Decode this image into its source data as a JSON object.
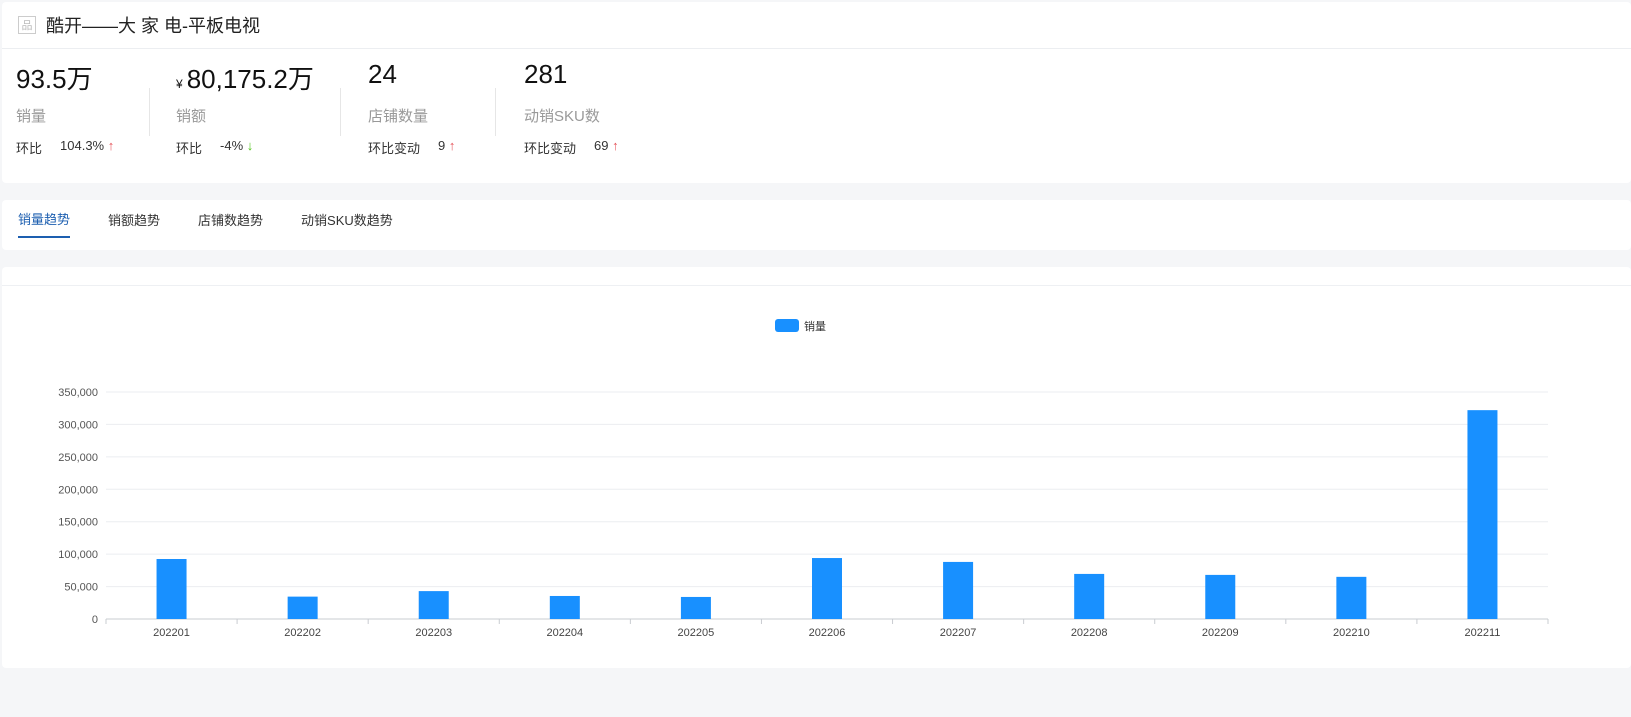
{
  "title": "酷开——大 家 电-平板电视",
  "stats": [
    {
      "value": "93.5万",
      "currency": "",
      "label": "销量",
      "change_label": "环比",
      "change": "104.3%",
      "dir": "up"
    },
    {
      "value": "80,175.2万",
      "currency": "¥",
      "label": "销额",
      "change_label": "环比",
      "change": "-4%",
      "dir": "down"
    },
    {
      "value": "24",
      "currency": "",
      "label": "店铺数量",
      "change_label": "环比变动",
      "change": "9",
      "dir": "up"
    },
    {
      "value": "281",
      "currency": "",
      "label": "动销SKU数",
      "change_label": "环比变动",
      "change": "69",
      "dir": "up"
    }
  ],
  "tabs": [
    "销量趋势",
    "销额趋势",
    "店铺数趋势",
    "动销SKU数趋势"
  ],
  "chart_data": {
    "type": "bar",
    "title": "",
    "legend": [
      "销量"
    ],
    "legend_position": "top-center",
    "categories": [
      "202201",
      "202202",
      "202203",
      "202204",
      "202205",
      "202206",
      "202207",
      "202208",
      "202209",
      "202210",
      "202211"
    ],
    "series": [
      {
        "name": "销量",
        "values": [
          92500,
          34500,
          43000,
          35500,
          34000,
          94000,
          88000,
          69500,
          68000,
          65000,
          322000
        ]
      }
    ],
    "yticks": [
      "0",
      "50,000",
      "100,000",
      "150,000",
      "200,000",
      "250,000",
      "300,000",
      "350,000"
    ],
    "ylim": [
      0,
      350000
    ],
    "color": "#1890ff"
  }
}
